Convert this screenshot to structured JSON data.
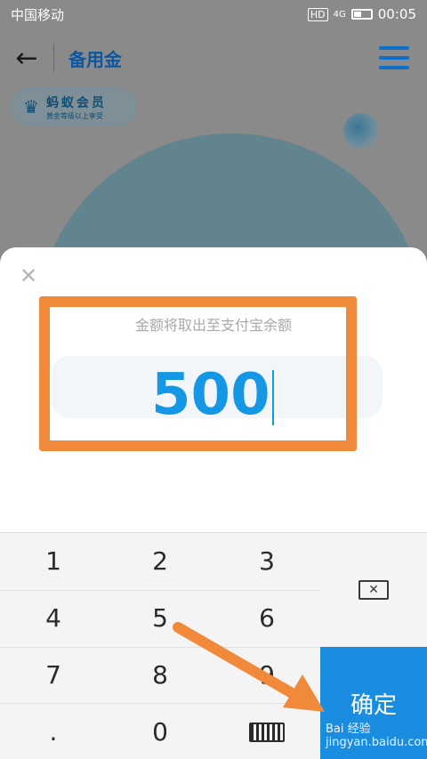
{
  "status_bar": {
    "carrier": "中国移动",
    "indicators": [
      "HD",
      "4G"
    ],
    "time": "00:05"
  },
  "nav": {
    "back_icon": "arrow-left-icon",
    "title": "备用金",
    "menu_icon": "menu-icon"
  },
  "member_badge": {
    "icon": "crown-icon",
    "title": "蚂蚁会员",
    "subtitle": "黄金等级以上享受"
  },
  "sheet": {
    "close_icon": "close-icon",
    "hint": "金额将取出至支付宝余额",
    "amount": "500"
  },
  "keypad": {
    "keys": [
      "1",
      "2",
      "3",
      "4",
      "5",
      "6",
      "7",
      "8",
      "9",
      ".",
      "0"
    ],
    "delete_icon": "backspace-icon",
    "keyboard_icon": "keyboard-icon",
    "confirm_label": "确定"
  },
  "watermark": "Bai 经验 jingyan.baidu.com",
  "colors": {
    "accent": "#1b8de0",
    "amount": "#1597e5",
    "highlight": "#f08a3a"
  }
}
